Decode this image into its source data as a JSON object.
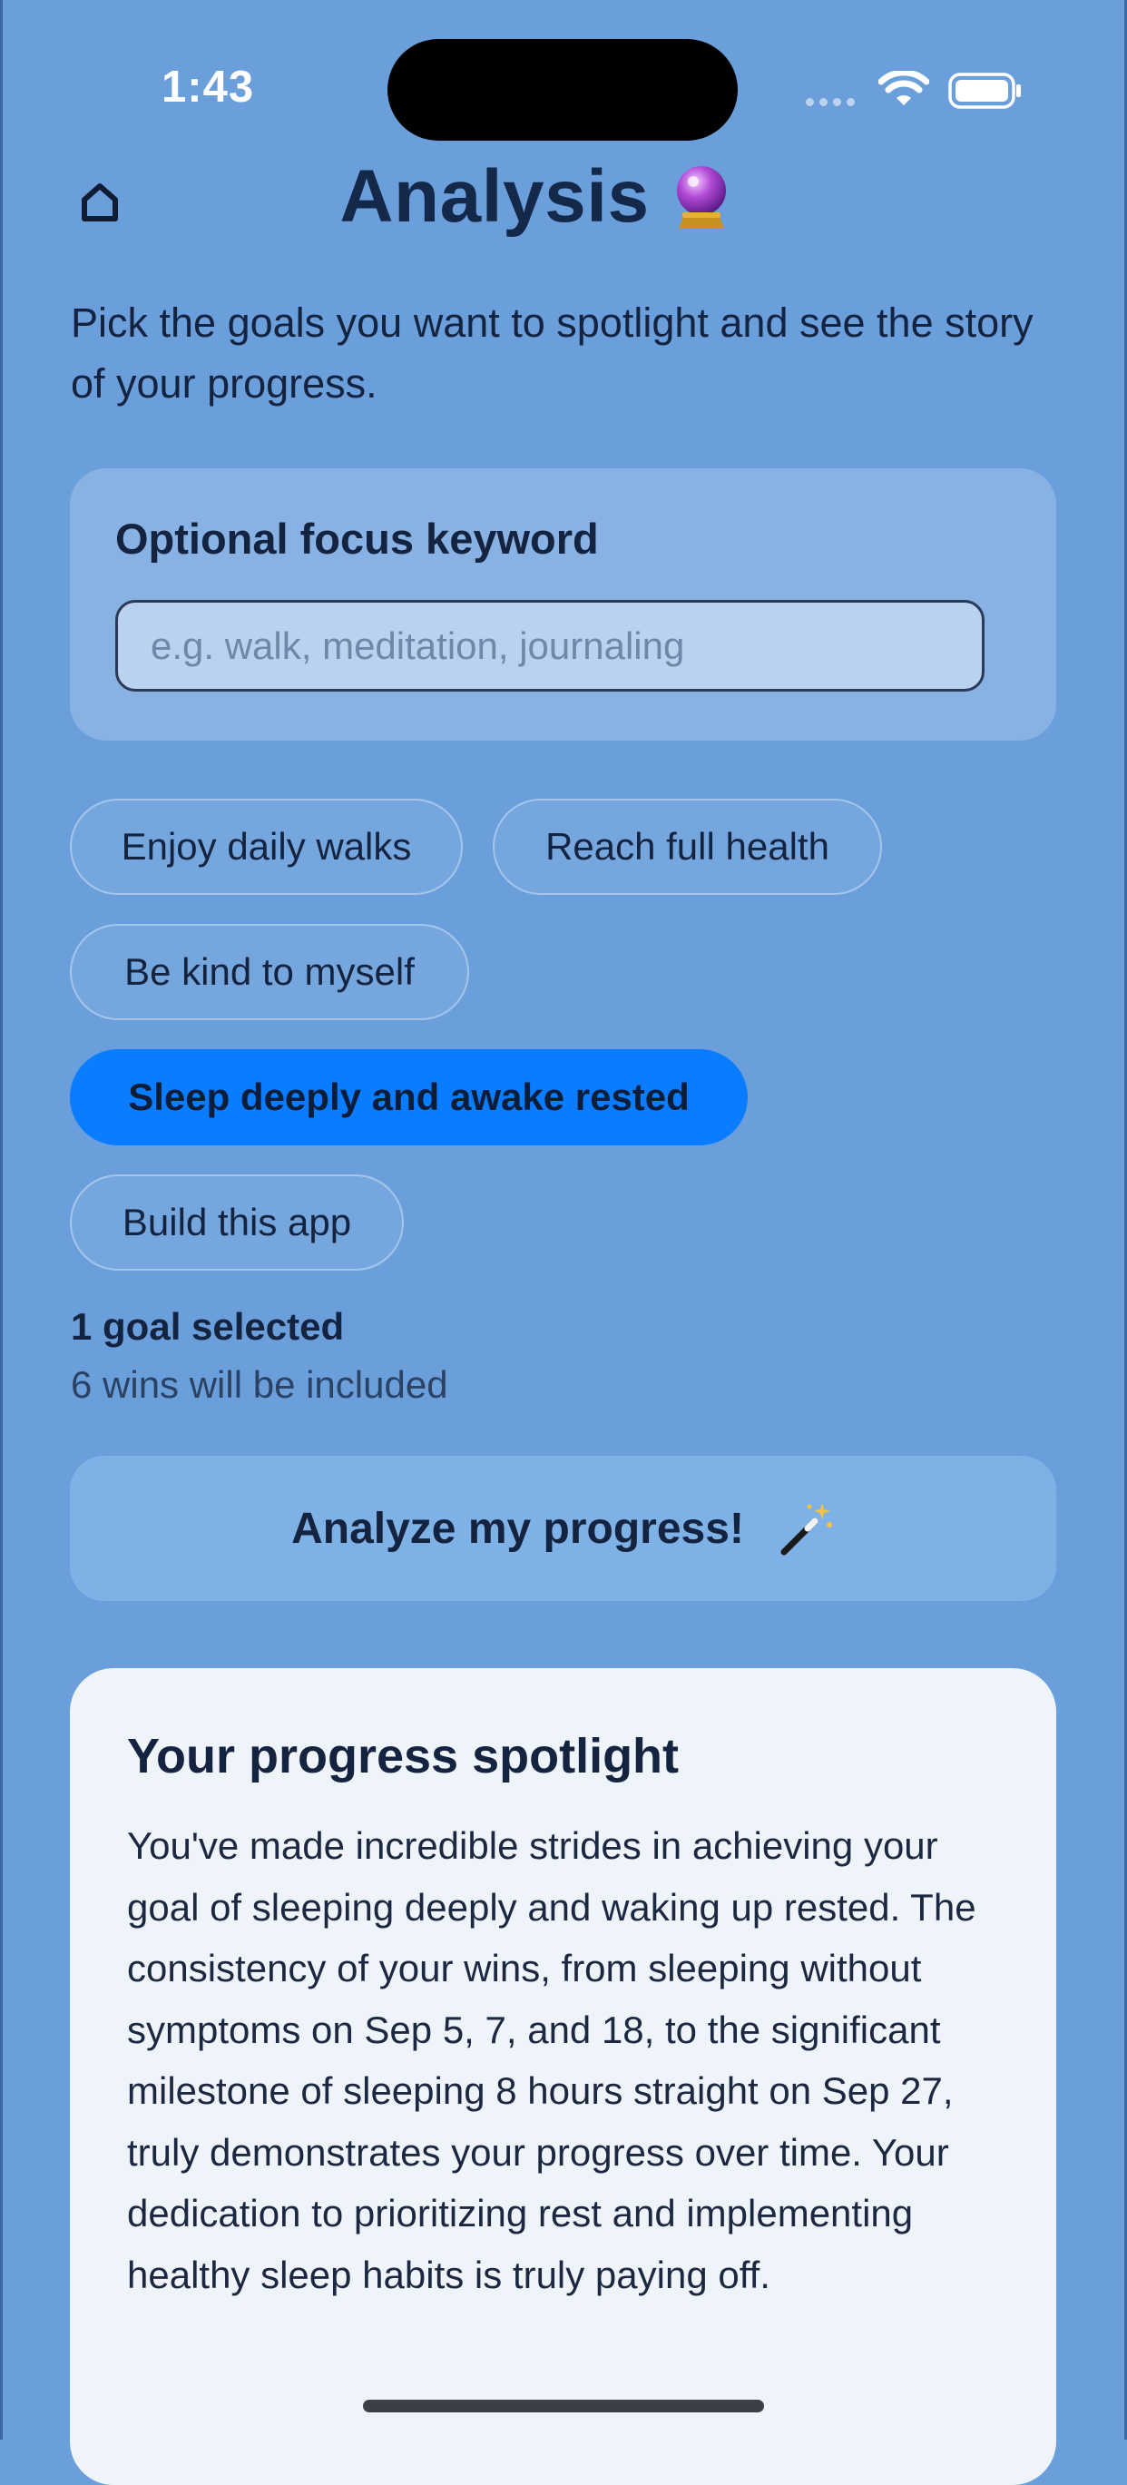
{
  "status_bar": {
    "time": "1:43"
  },
  "header": {
    "title": "Analysis",
    "title_emoji": "crystal-ball-icon",
    "home_icon": "home-icon"
  },
  "subtitle": "Pick the goals you want to spotlight and see the story of your progress.",
  "keyword": {
    "label": "Optional focus keyword",
    "value": "",
    "placeholder": "e.g. walk, meditation, journaling"
  },
  "goals": [
    {
      "label": "Enjoy daily walks",
      "selected": false
    },
    {
      "label": "Reach full health",
      "selected": false
    },
    {
      "label": "Be kind to myself",
      "selected": false
    },
    {
      "label": "Sleep deeply and awake rested",
      "selected": true
    },
    {
      "label": "Build this app",
      "selected": false
    }
  ],
  "selection": {
    "count_text": "1 goal selected",
    "wins_text": "6 wins will be included"
  },
  "analyze_button": {
    "label": "Analyze my progress!",
    "icon": "magic-wand-icon"
  },
  "spotlight": {
    "title": "Your progress spotlight",
    "body": "You've made incredible strides in achieving your goal of sleeping deeply and waking up rested. The consistency of your wins, from sleeping without symptoms on Sep 5, 7, and 18, to the significant milestone of sleeping 8 hours straight on Sep 27, truly demonstrates your progress over time. Your dedication to prioritizing rest and implementing healthy sleep habits is truly paying off."
  },
  "colors": {
    "background": "#6a9fdc",
    "accent": "#0a7cff",
    "card": "#eff4fb",
    "text": "#14233f"
  }
}
